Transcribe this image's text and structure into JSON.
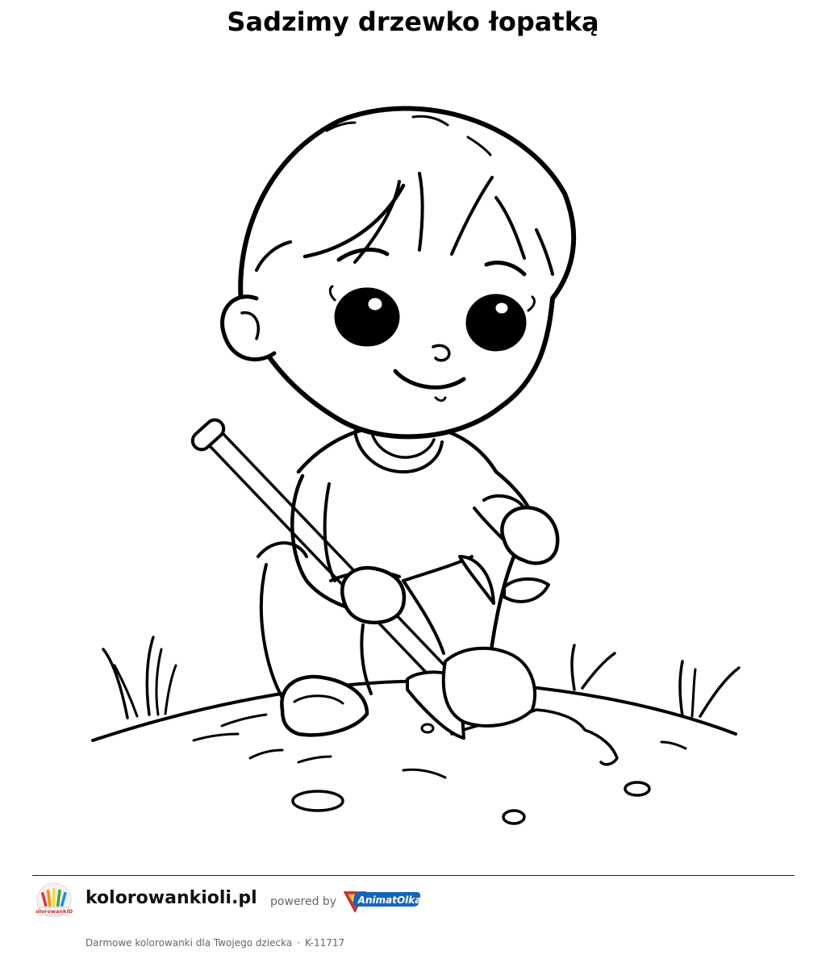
{
  "page": {
    "title": "Sadzimy drzewko łopatką"
  },
  "illustration": {
    "icon": "boy-planting-tree-coloring-icon"
  },
  "footer": {
    "logo_text": "KolorowankiOli",
    "site_name": "kolorowankioli.pl",
    "powered_by": "powered by",
    "brand_text": "AnimatOlka",
    "tagline": "Darmowe kolorowanki dla Twojego dziecka",
    "separator": "·",
    "code": "K-11717"
  }
}
